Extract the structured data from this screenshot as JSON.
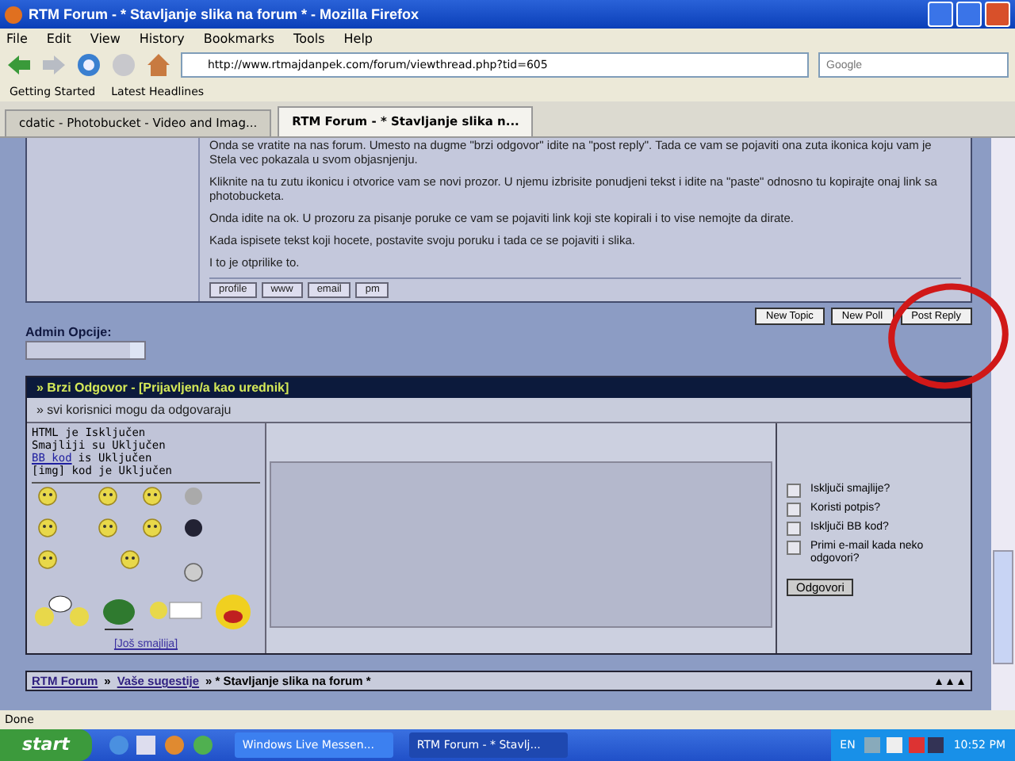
{
  "window": {
    "title": "RTM Forum - * Stavljanje slika na forum * - Mozilla Firefox"
  },
  "menu": [
    "File",
    "Edit",
    "View",
    "History",
    "Bookmarks",
    "Tools",
    "Help"
  ],
  "toolbar": {
    "url": "http://www.rtmajdanpek.com/forum/viewthread.php?tid=605",
    "search": {
      "placeholder": "Google"
    }
  },
  "bookmarks": [
    "Getting Started",
    "Latest Headlines"
  ],
  "tabs": [
    {
      "label": "cdatic - Photobucket - Video and Imag...",
      "selected": false
    },
    {
      "label": "RTM Forum - * Stavljanje slika n...",
      "selected": true
    }
  ],
  "post": {
    "paragraphs": [
      "Onda se vratite na nas forum. Umesto na dugme \"brzi odgovor\" idite na \"post reply\". Tada ce vam se pojaviti ona zuta ikonica koju vam je Stela vec pokazala u svom objasnjenju.",
      "Kliknite na tu zutu ikonicu i otvorice vam se novi prozor. U njemu izbrisite ponudjeni tekst i idite na \"paste\" odnosno tu kopirajte onaj link sa photobucketa.",
      "Onda idite na ok. U prozoru za pisanje poruke ce vam se pojaviti link koji ste kopirali i to vise nemojte da dirate.",
      "Kada ispisete tekst koji hocete, postavite svoju poruku i tada ce se pojaviti i slika.",
      "I to je otprilike to."
    ],
    "buttons": [
      "profile",
      "www",
      "email",
      "pm"
    ]
  },
  "thread_buttons": [
    "New Topic",
    "New Poll",
    "Post Reply"
  ],
  "admin": {
    "label": "Admin Opcije:"
  },
  "quick_reply": {
    "title": "» Brzi Odgovor - [Prijavljen/a kao **urednik**]",
    "note": "» svi korisnici mogu da odgovaraju",
    "status_lines": [
      {
        "text": "HTML je Isključen"
      },
      {
        "text": "Smajliji su Uključen"
      },
      {
        "link": "BB kod",
        "text": "is Uključen"
      },
      {
        "text": "[img] kod je Uključen"
      }
    ],
    "more_smileys": "[Još smajlija]",
    "options": [
      {
        "label": "Isključi smajlije?",
        "checked": false
      },
      {
        "label": "Koristi potpis?",
        "checked": false
      },
      {
        "label": "Isključi BB kod?",
        "checked": false
      },
      {
        "label": "Primi e-mail kada neko odgovori?",
        "checked": false
      }
    ],
    "submit": "Odgovori"
  },
  "breadcrumb": [
    {
      "label": "RTM Forum",
      "kind": "link"
    },
    {
      "label": "»",
      "kind": "sep"
    },
    {
      "label": "Vaše sugestije",
      "kind": "link"
    },
    {
      "label": "» * Stavljanje slika na forum *",
      "kind": "current"
    }
  ],
  "status_bar": "Done",
  "taskbar": {
    "start": "start",
    "tasks": [
      {
        "label": "Windows Live Messen...",
        "selected": false
      },
      {
        "label": "RTM Forum - * Stavlj...",
        "selected": true
      }
    ],
    "language": "EN",
    "clock": "10:52 PM"
  }
}
